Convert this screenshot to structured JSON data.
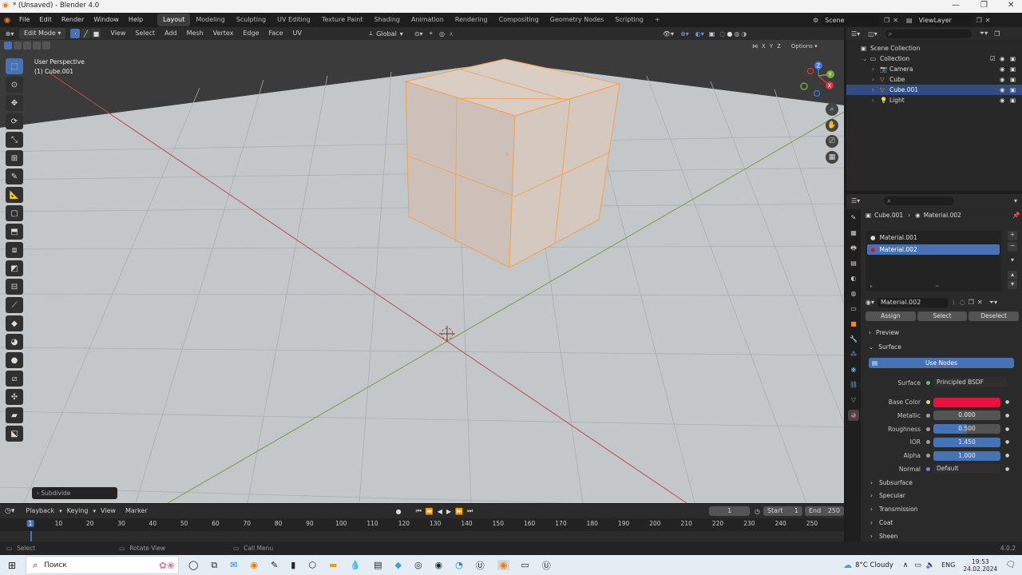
{
  "window": {
    "title": "* (Unsaved) - Blender 4.0",
    "controls": [
      "—",
      "❐",
      "✕"
    ]
  },
  "menus": [
    "File",
    "Edit",
    "Render",
    "Window",
    "Help"
  ],
  "workspaces": [
    "Layout",
    "Modeling",
    "Sculpting",
    "UV Editing",
    "Texture Paint",
    "Shading",
    "Animation",
    "Rendering",
    "Compositing",
    "Geometry Nodes",
    "Scripting"
  ],
  "active_workspace": "Layout",
  "scene_field": "Scene",
  "viewlayer_field": "ViewLayer",
  "viewport_header": {
    "mode": "Edit Mode",
    "menus": [
      "View",
      "Select",
      "Add",
      "Mesh",
      "Vertex",
      "Edge",
      "Face",
      "UV"
    ],
    "transform": "Global",
    "options_label": "Options",
    "axes": [
      "X",
      "Y",
      "Z"
    ]
  },
  "viewport": {
    "perspective": "User Perspective",
    "object": "(1) Cube.001",
    "operator_panel": "Subdivide",
    "gizmo_labels": [
      "Z",
      "Y",
      "X"
    ]
  },
  "outliner": {
    "items": [
      {
        "label": "Scene Collection",
        "indent": 0
      },
      {
        "label": "Collection",
        "indent": 1
      },
      {
        "label": "Camera",
        "indent": 2,
        "icon": "camera-icon"
      },
      {
        "label": "Cube",
        "indent": 2,
        "icon": "mesh-icon"
      },
      {
        "label": "Cube.001",
        "indent": 2,
        "icon": "mesh-icon",
        "selected": true
      },
      {
        "label": "Light",
        "indent": 2,
        "icon": "light-icon"
      }
    ]
  },
  "properties": {
    "breadcrumb_object": "Cube.001",
    "breadcrumb_material": "Material.002",
    "slots": [
      "Material.001",
      "Material.002"
    ],
    "selected_slot": "Material.002",
    "material_name": "Material.002",
    "actions": [
      "Assign",
      "Select",
      "Deselect"
    ],
    "panels": {
      "preview": "Preview",
      "surface": "Surface"
    },
    "use_nodes": "Use Nodes",
    "surface_label": "Surface",
    "surface_value": "Principled BSDF",
    "fields": [
      {
        "label": "Base Color",
        "value": "",
        "color": "#e0143c"
      },
      {
        "label": "Metallic",
        "value": "0.000",
        "fill": 0.0
      },
      {
        "label": "Roughness",
        "value": "0.500",
        "fill": 0.5
      },
      {
        "label": "IOR",
        "value": "1.450",
        "fill": 1.0
      },
      {
        "label": "Alpha",
        "value": "1.000",
        "fill": 1.0
      },
      {
        "label": "Normal",
        "value": "Default"
      }
    ],
    "subsections": [
      "Subsurface",
      "Specular",
      "Transmission",
      "Coat",
      "Sheen"
    ]
  },
  "timeline": {
    "menus": [
      "Playback",
      "Keying",
      "View",
      "Marker"
    ],
    "current_frame": "1",
    "start_label": "Start",
    "start": "1",
    "end_label": "End",
    "end": "250",
    "ticks": [
      "1",
      "10",
      "20",
      "30",
      "40",
      "50",
      "60",
      "70",
      "80",
      "90",
      "100",
      "110",
      "120",
      "130",
      "140",
      "150",
      "160",
      "170",
      "180",
      "190",
      "200",
      "210",
      "220",
      "230",
      "240",
      "250"
    ]
  },
  "statusbar": {
    "items": [
      "Select",
      "Rotate View",
      "Call Menu"
    ],
    "version": "4.0.2"
  },
  "taskbar": {
    "search": "Поиск",
    "weather": "8°C Cloudy",
    "lang": "ENG",
    "time": "19:53",
    "date": "24.02.2024"
  },
  "colors": {
    "accent": "#4772b3",
    "selection_orange": "#f5a14a",
    "base_color": "#e0143c"
  }
}
